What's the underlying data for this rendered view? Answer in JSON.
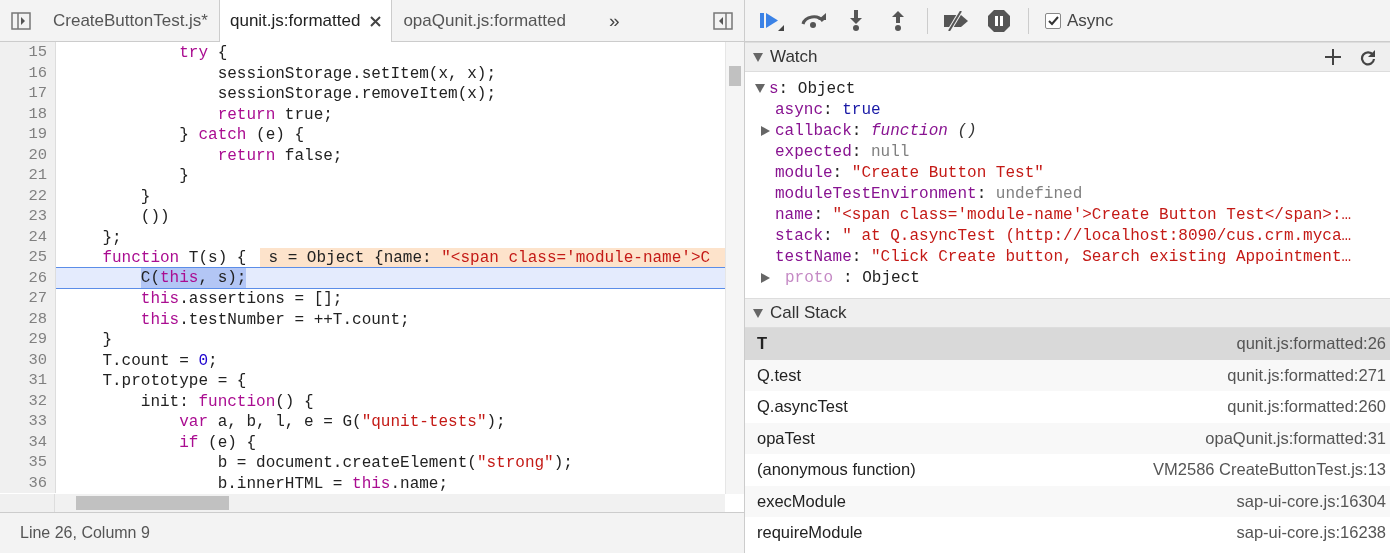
{
  "editor": {
    "tabs": [
      {
        "label": "CreateButtonTest.js*",
        "selected": false
      },
      {
        "label": "qunit.js:formatted",
        "selected": true
      },
      {
        "label": "opaQunit.js:formatted",
        "selected": false
      }
    ],
    "overflow_label": "»",
    "lines": [
      {
        "number": "15",
        "selected": false,
        "tokens": [
          {
            "kind": "keyword",
            "text": "            try"
          },
          {
            "kind": "plain",
            "text": " {"
          }
        ]
      },
      {
        "number": "16",
        "selected": false,
        "tokens": [
          {
            "kind": "plain",
            "text": "                sessionStorage.setItem(x, x);"
          }
        ]
      },
      {
        "number": "17",
        "selected": false,
        "tokens": [
          {
            "kind": "plain",
            "text": "                sessionStorage.removeItem(x);"
          }
        ]
      },
      {
        "number": "18",
        "selected": false,
        "tokens": [
          {
            "kind": "keyword",
            "text": "                return"
          },
          {
            "kind": "plain",
            "text": " true;"
          }
        ]
      },
      {
        "number": "19",
        "selected": false,
        "tokens": [
          {
            "kind": "plain",
            "text": "            } "
          },
          {
            "kind": "keyword",
            "text": "catch"
          },
          {
            "kind": "plain",
            "text": " (e) {"
          }
        ]
      },
      {
        "number": "20",
        "selected": false,
        "tokens": [
          {
            "kind": "keyword",
            "text": "                return"
          },
          {
            "kind": "plain",
            "text": " false;"
          }
        ]
      },
      {
        "number": "21",
        "selected": false,
        "tokens": [
          {
            "kind": "plain",
            "text": "            }"
          }
        ]
      },
      {
        "number": "22",
        "selected": false,
        "tokens": [
          {
            "kind": "plain",
            "text": "        }"
          }
        ]
      },
      {
        "number": "23",
        "selected": false,
        "tokens": [
          {
            "kind": "plain",
            "text": "        ())"
          }
        ]
      },
      {
        "number": "24",
        "selected": false,
        "tokens": [
          {
            "kind": "plain",
            "text": "    };"
          }
        ]
      },
      {
        "number": "25",
        "selected": false,
        "tokens": [
          {
            "kind": "keyword",
            "text": "    function"
          },
          {
            "kind": "plain",
            "text": " T(s) {"
          }
        ],
        "inline_value": [
          {
            "kind": "plain",
            "text": "s = Object {name: "
          },
          {
            "kind": "string",
            "text": "\"<span class='module-name'>C"
          }
        ]
      },
      {
        "number": "26",
        "selected": true,
        "tokens": [
          {
            "kind": "plain",
            "text": "        C(",
            "selected": true
          },
          {
            "kind": "keyword",
            "text": "this",
            "selected": true
          },
          {
            "kind": "plain",
            "text": ", s);",
            "selected": true
          }
        ]
      },
      {
        "number": "27",
        "selected": false,
        "tokens": [
          {
            "kind": "keyword",
            "text": "        this"
          },
          {
            "kind": "plain",
            "text": ".assertions = [];"
          }
        ]
      },
      {
        "number": "28",
        "selected": false,
        "tokens": [
          {
            "kind": "keyword",
            "text": "        this"
          },
          {
            "kind": "plain",
            "text": ".testNumber = ++T.count;"
          }
        ]
      },
      {
        "number": "29",
        "selected": false,
        "tokens": [
          {
            "kind": "plain",
            "text": "    }"
          }
        ]
      },
      {
        "number": "30",
        "selected": false,
        "tokens": [
          {
            "kind": "plain",
            "text": "    T.count = "
          },
          {
            "kind": "number",
            "text": "0"
          },
          {
            "kind": "plain",
            "text": ";"
          }
        ]
      },
      {
        "number": "31",
        "selected": false,
        "tokens": [
          {
            "kind": "plain",
            "text": "    T.prototype = {"
          }
        ]
      },
      {
        "number": "32",
        "selected": false,
        "tokens": [
          {
            "kind": "plain",
            "text": "        init: "
          },
          {
            "kind": "keyword",
            "text": "function"
          },
          {
            "kind": "plain",
            "text": "() {"
          }
        ]
      },
      {
        "number": "33",
        "selected": false,
        "tokens": [
          {
            "kind": "keyword",
            "text": "            var"
          },
          {
            "kind": "plain",
            "text": " a, b, l, e = G("
          },
          {
            "kind": "string",
            "text": "\"qunit-tests\""
          },
          {
            "kind": "plain",
            "text": ");"
          }
        ]
      },
      {
        "number": "34",
        "selected": false,
        "tokens": [
          {
            "kind": "keyword",
            "text": "            if"
          },
          {
            "kind": "plain",
            "text": " (e) {"
          }
        ]
      },
      {
        "number": "35",
        "selected": false,
        "tokens": [
          {
            "kind": "plain",
            "text": "                b = document.createElement("
          },
          {
            "kind": "string",
            "text": "\"strong\""
          },
          {
            "kind": "plain",
            "text": ");"
          }
        ]
      },
      {
        "number": "36",
        "selected": false,
        "tokens": [
          {
            "kind": "plain",
            "text": "                b.innerHTML = "
          },
          {
            "kind": "keyword",
            "text": "this"
          },
          {
            "kind": "plain",
            "text": ".name;"
          }
        ]
      }
    ],
    "status": "Line 26, Column 9"
  },
  "debugger": {
    "async": {
      "label": "Async",
      "checked": true
    },
    "watch": {
      "title": "Watch",
      "expanded": true,
      "root": {
        "name": "s",
        "separator": ":",
        "value": "Object",
        "expanded": true,
        "children": [
          {
            "name": "async",
            "separator": ":",
            "value": "true",
            "kind": "boolean",
            "dimmed": false
          },
          {
            "name": "callback",
            "separator": ":",
            "value": "function",
            "signature": "()",
            "kind": "function",
            "expanded": false,
            "dimmed": false
          },
          {
            "name": "expected",
            "separator": ":",
            "value": "null",
            "kind": "empty",
            "dimmed": false
          },
          {
            "name": "module",
            "separator": ":",
            "value": "\"Create Button Test\"",
            "kind": "string",
            "dimmed": false
          },
          {
            "name": "moduleTestEnvironment",
            "separator": ":",
            "value": "undefined",
            "kind": "empty",
            "dimmed": false
          },
          {
            "name": "name",
            "separator": ":",
            "value": "\"<span class='module-name'>Create Button Test</span>:…",
            "kind": "string",
            "dimmed": false
          },
          {
            "name": "stack",
            "separator": ":",
            "value": "\" at Q.asyncTest (http://localhost:8090/cus.crm.myca…",
            "kind": "string",
            "dimmed": false
          },
          {
            "name": "testName",
            "separator": ":",
            "value": "\"Click Create button, Search existing Appointment…",
            "kind": "string",
            "dimmed": false
          },
          {
            "name": "proto",
            "separator": ":",
            "value": "Object",
            "kind": "object",
            "expanded": false,
            "dimmed": true
          }
        ]
      }
    },
    "call_stack": {
      "title": "Call Stack",
      "expanded": true,
      "frames": [
        {
          "function": "T",
          "location": "qunit.js:formatted:26",
          "selected": true
        },
        {
          "function": "Q.test",
          "location": "qunit.js:formatted:271",
          "selected": false
        },
        {
          "function": "Q.asyncTest",
          "location": "qunit.js:formatted:260",
          "selected": false
        },
        {
          "function": "opaTest",
          "location": "opaQunit.js:formatted:31",
          "selected": false
        },
        {
          "function": "(anonymous function)",
          "location": "VM2586 CreateButtonTest.js:13",
          "selected": false
        },
        {
          "function": "execModule",
          "location": "sap-ui-core.js:16304",
          "selected": false
        },
        {
          "function": "requireModule",
          "location": "sap-ui-core.js:16238",
          "selected": false
        }
      ]
    }
  }
}
